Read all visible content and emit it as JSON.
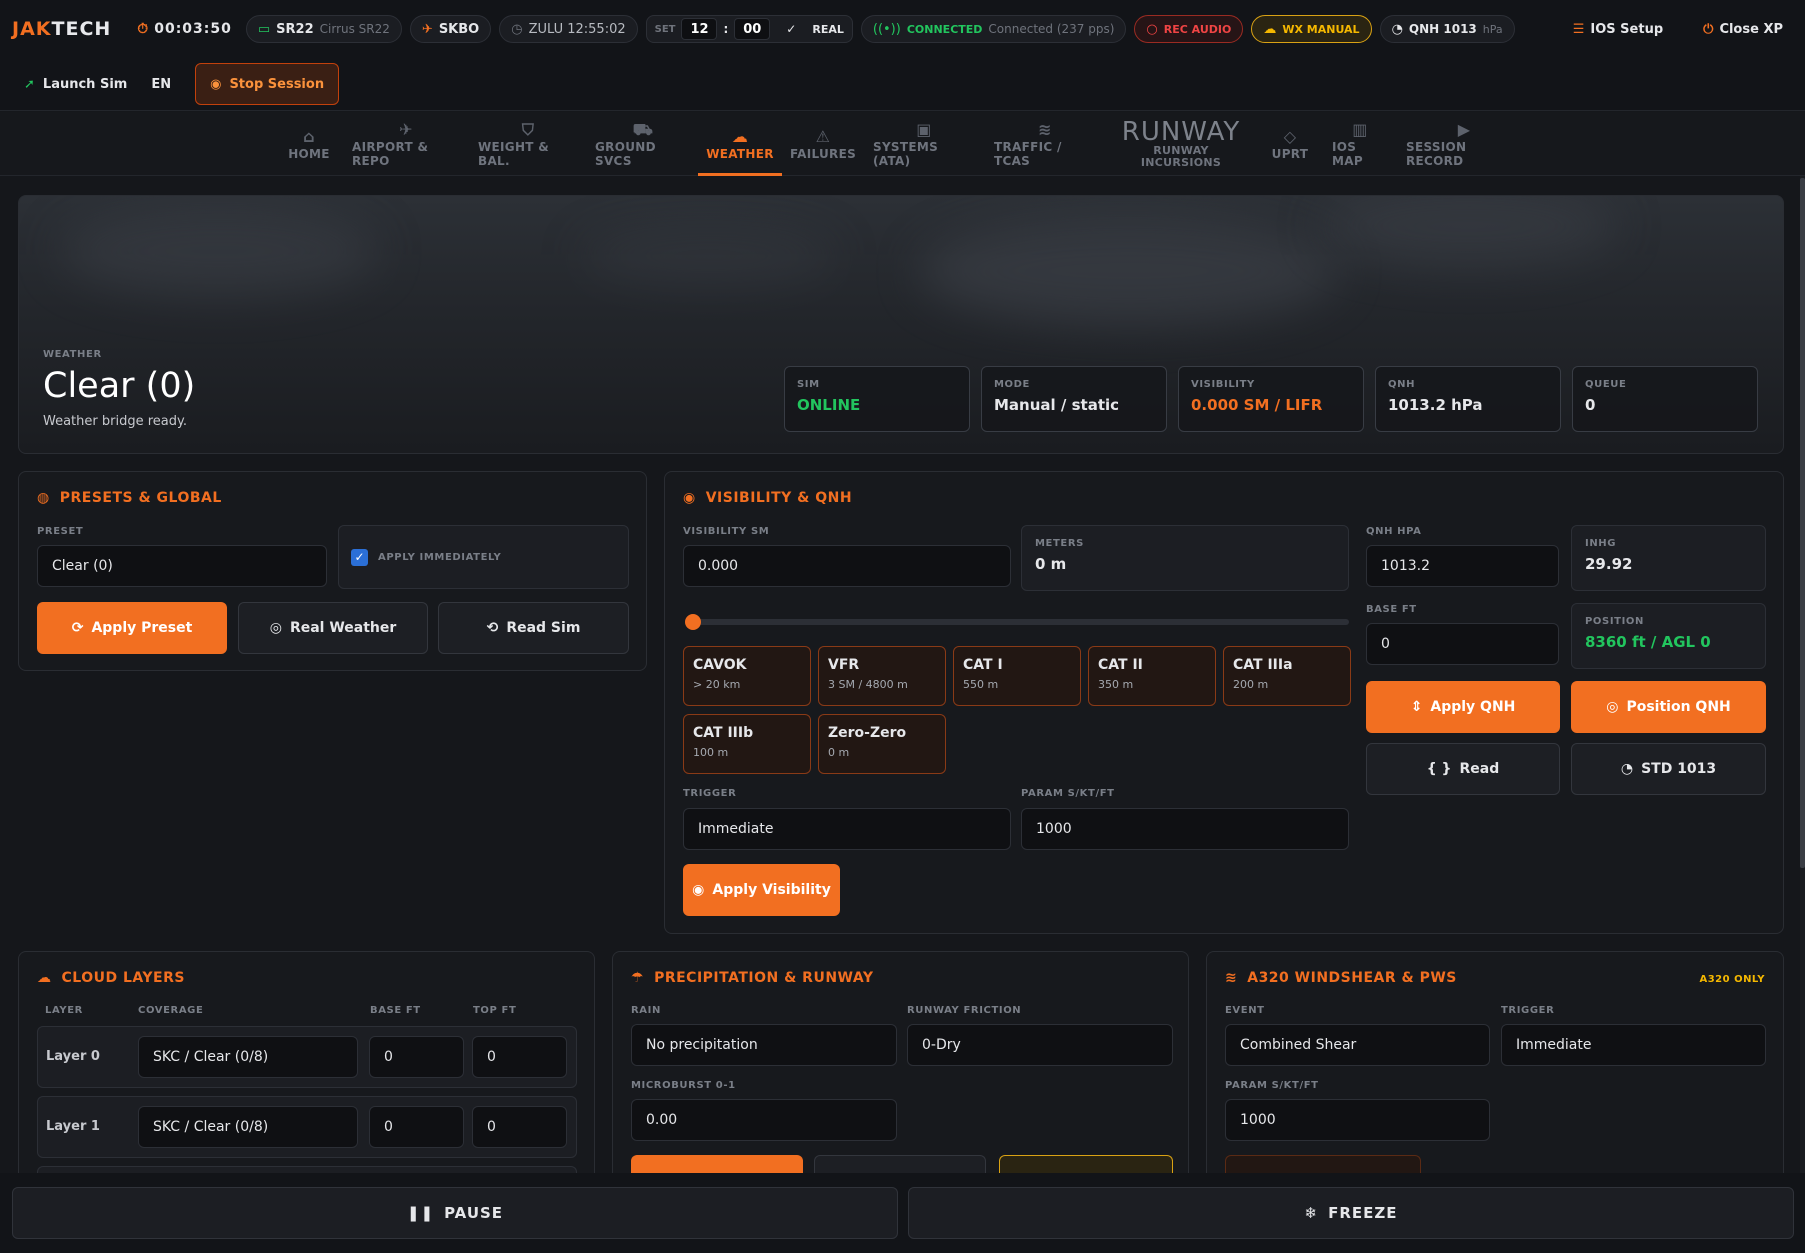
{
  "topbar": {
    "logo_a": "JAK",
    "logo_b": "TECH",
    "timer": "00:03:50",
    "aircraft_code": "SR22",
    "aircraft_name": "Cirrus SR22",
    "airport": "SKBO",
    "zulu": "ZULU 12:55:02",
    "set_label": "SET",
    "set_hh": "12",
    "set_mm": "00",
    "real_label": "REAL",
    "connected": "CONNECTED",
    "connected_sub": "Connected (237 pps)",
    "rec_audio": "REC AUDIO",
    "wx_manual": "WX MANUAL",
    "qnh": "QNH 1013",
    "qnh_unit": "hPa",
    "ios_setup": "IOS Setup",
    "close_xp": "Close XP"
  },
  "bar2": {
    "launch_sim": "Launch Sim",
    "lang": "EN",
    "stop_session": "Stop Session"
  },
  "nav": {
    "home": "HOME",
    "airport": "AIRPORT & REPO",
    "weight": "WEIGHT & BAL.",
    "ground": "GROUND SVCS",
    "weather": "WEATHER",
    "failures": "FAILURES",
    "systems": "SYSTEMS (ATA)",
    "traffic": "TRAFFIC / TCAS",
    "runway_big": "RUNWAY",
    "runway_1": "RUNWAY",
    "runway_2": "INCURSIONS",
    "uprt": "UPRT",
    "ios_map": "IOS MAP",
    "session_record": "SESSION RECORD"
  },
  "hero": {
    "label": "WEATHER",
    "title": "Clear (0)",
    "subtitle": "Weather bridge ready.",
    "stats": [
      {
        "label": "SIM",
        "value": "ONLINE"
      },
      {
        "label": "MODE",
        "value": "Manual / static"
      },
      {
        "label": "VISIBILITY",
        "value": "0.000 SM / LIFR"
      },
      {
        "label": "QNH",
        "value": "1013.2 hPa"
      },
      {
        "label": "QUEUE",
        "value": "0"
      }
    ]
  },
  "presets": {
    "title": "PRESETS & GLOBAL",
    "preset_label": "PRESET",
    "preset_value": "Clear (0)",
    "apply_immediately": "APPLY IMMEDIATELY",
    "apply_preset": "Apply Preset",
    "real_weather": "Real Weather",
    "read_sim": "Read Sim"
  },
  "visibility": {
    "title": "VISIBILITY & QNH",
    "vis_label": "VISIBILITY SM",
    "vis_value": "0.000",
    "meters_label": "METERS",
    "meters_value": "0 m",
    "slider_level": 0,
    "presets": [
      {
        "name": "CAVOK",
        "sub": "> 20 km"
      },
      {
        "name": "VFR",
        "sub": "3 SM / 4800 m"
      },
      {
        "name": "CAT I",
        "sub": "550 m"
      },
      {
        "name": "CAT II",
        "sub": "350 m"
      },
      {
        "name": "CAT IIIa",
        "sub": "200 m"
      },
      {
        "name": "CAT IIIb",
        "sub": "100 m"
      },
      {
        "name": "Zero-Zero",
        "sub": "0 m"
      }
    ],
    "trigger_label": "TRIGGER",
    "trigger_value": "Immediate",
    "param_label": "PARAM S/KT/FT",
    "param_value": "1000",
    "apply_visibility": "Apply Visibility",
    "qnh_label": "QNH HPA",
    "qnh_value": "1013.2",
    "inhg_label": "INHG",
    "inhg_value": "29.92",
    "base_label": "BASE FT",
    "base_value": "0",
    "position_label": "POSITION",
    "position_value": "8360 ft / AGL 0",
    "apply_qnh": "Apply QNH",
    "position_qnh": "Position QNH",
    "read": "Read",
    "std": "STD 1013"
  },
  "clouds": {
    "title": "CLOUD LAYERS",
    "col_layer": "LAYER",
    "col_coverage": "COVERAGE",
    "col_base": "BASE FT",
    "col_top": "TOP FT",
    "rows": [
      {
        "layer": "Layer 0",
        "coverage": "SKC / Clear (0/8)",
        "base": "0",
        "top": "0"
      },
      {
        "layer": "Layer 1",
        "coverage": "SKC / Clear (0/8)",
        "base": "0",
        "top": "0"
      }
    ]
  },
  "precip": {
    "title": "PRECIPITATION & RUNWAY",
    "rain_label": "RAIN",
    "rain_value": "No precipitation",
    "friction_label": "RUNWAY FRICTION",
    "friction_value": "0-Dry",
    "microburst_label": "MICROBURST 0-1",
    "microburst_value": "0.00"
  },
  "windshear": {
    "title": "A320 WINDSHEAR & PWS",
    "badge": "A320 ONLY",
    "event_label": "EVENT",
    "event_value": "Combined Shear",
    "trigger_label": "TRIGGER",
    "trigger_value": "Immediate",
    "param_label": "PARAM S/KT/FT",
    "param_value": "1000"
  },
  "bottom": {
    "pause": "PAUSE",
    "freeze": "FREEZE"
  },
  "colors": {
    "accent": "#f26f21",
    "online": "#22c55e",
    "background": "#15171b"
  }
}
